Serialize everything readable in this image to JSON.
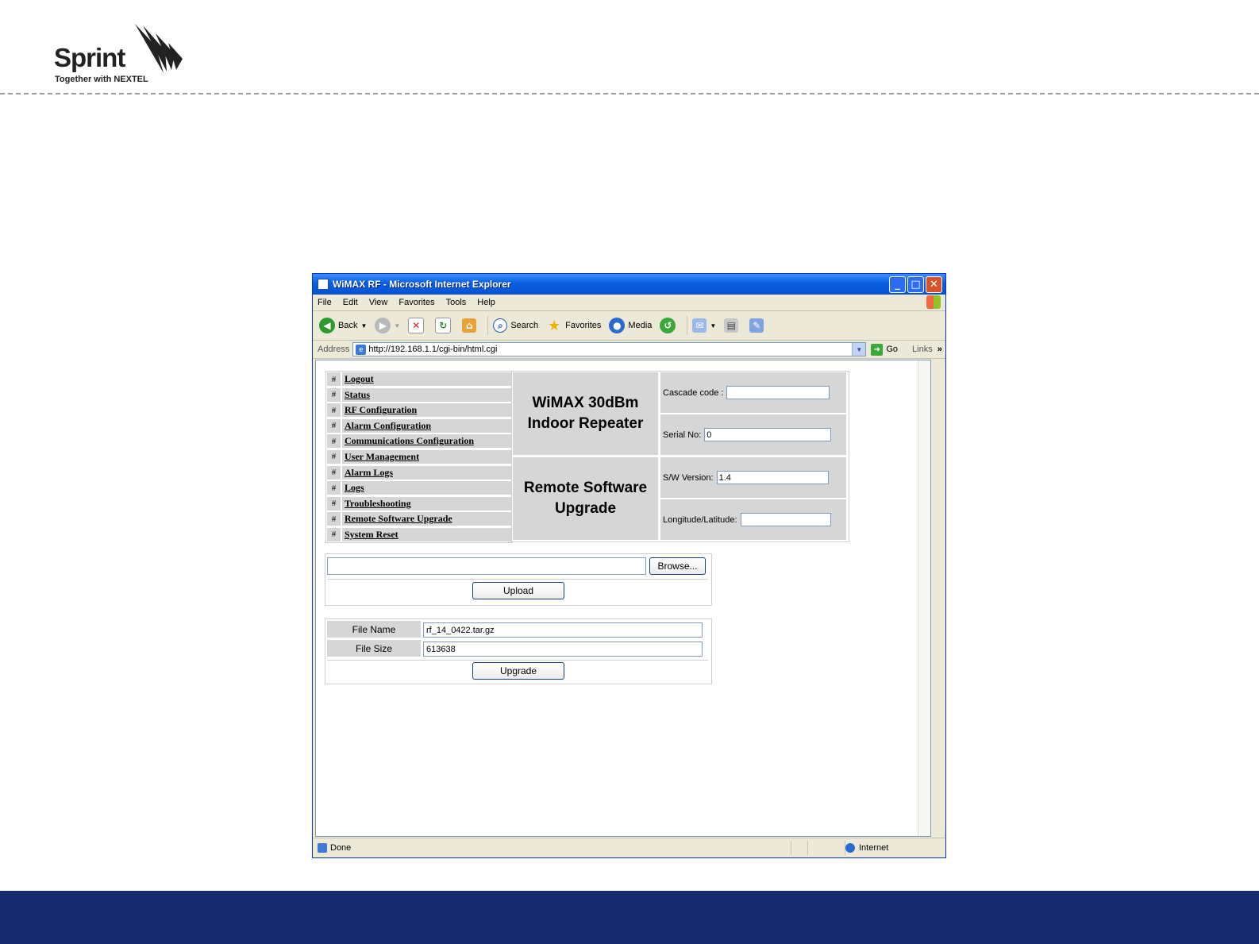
{
  "slide": {
    "logo_word": "Sprint",
    "logo_tagline": "Together with NEXTEL",
    "footer_color": "#16296e"
  },
  "window": {
    "title": "WiMAX RF - Microsoft Internet Explorer",
    "controls": {
      "minimize": "_",
      "maximize": "□",
      "close": "✕"
    }
  },
  "menubar": [
    "File",
    "Edit",
    "View",
    "Favorites",
    "Tools",
    "Help"
  ],
  "toolbar": {
    "back": "Back",
    "search": "Search",
    "favorites": "Favorites",
    "media": "Media"
  },
  "address": {
    "label": "Address",
    "url": "http://192.168.1.1/cgi-bin/html.cgi",
    "go": "Go",
    "links": "Links"
  },
  "nav": {
    "hash": "#",
    "items": [
      "Logout",
      "Status",
      "RF Configuration",
      "Alarm Configuration",
      "Communications Configuration",
      "User Management",
      "Alarm Logs",
      "Logs",
      "Troubleshooting",
      "Remote Software Upgrade",
      "System Reset"
    ]
  },
  "device": {
    "product_line1": "WiMAX 30dBm",
    "product_line2": "Indoor Repeater",
    "page_line1": "Remote Software",
    "page_line2": "Upgrade",
    "cascade_label": "Cascade code :",
    "cascade_value": "",
    "serial_label": "Serial No:",
    "serial_value": "0",
    "sw_label": "S/W Version:",
    "sw_value": "1.4",
    "longlat_label": "Longitude/Latitude:",
    "longlat_value": ""
  },
  "upload": {
    "browse_label": "Browse...",
    "upload_label": "Upload",
    "file_path": ""
  },
  "fileinfo": {
    "name_label": "File Name",
    "name_value": "rf_14_0422.tar.gz",
    "size_label": "File Size",
    "size_value": "613638",
    "upgrade_label": "Upgrade"
  },
  "status": {
    "text": "Done",
    "zone": "Internet"
  }
}
